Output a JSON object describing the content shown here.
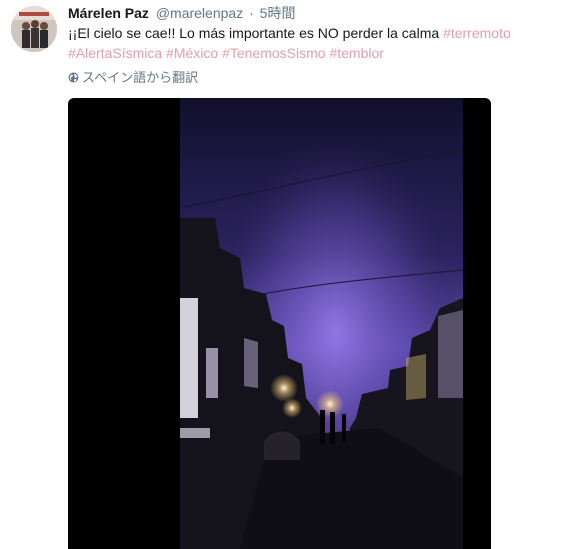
{
  "author": {
    "name": "Márelen Paz",
    "handle": "@marelenpaz",
    "separator": "·",
    "time": "5時間"
  },
  "tweet": {
    "text": "¡¡El cielo se cae!! Lo más importante es NO perder la calma ",
    "hashtags": [
      "#terremoto",
      "#AlertaSísmica",
      "#México",
      "#TenemosSismo",
      "#temblor"
    ]
  },
  "translate_label": "スペイン語から翻訳",
  "colors": {
    "hashtag": "#e0a0ad",
    "secondary_text": "#657786",
    "sky_glow": "#8a6ed8"
  },
  "icons": {
    "translate": "globe-icon"
  }
}
